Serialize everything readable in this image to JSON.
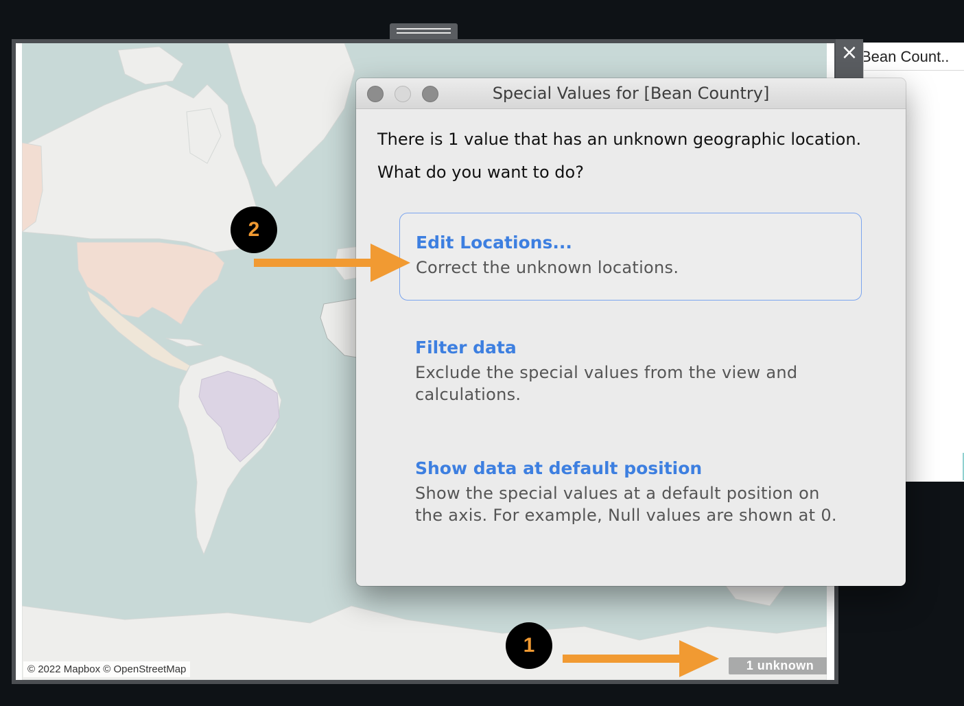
{
  "map": {
    "attribution": "© 2022 Mapbox © OpenStreetMap",
    "unknown_badge": "1 unknown"
  },
  "side_panel": {
    "title": "Bean Count..",
    "close_icon": "×"
  },
  "dialog": {
    "title": "Special Values for [Bean Country]",
    "message_line1": "There is 1 value that has an unknown geographic location.",
    "message_line2": "What do you want to do?",
    "options": [
      {
        "title": "Edit Locations...",
        "description": "Correct the unknown locations."
      },
      {
        "title": "Filter data",
        "description": "Exclude the special values from the view and calculations."
      },
      {
        "title": "Show data at default position",
        "description": "Show the special values at a default position on the axis. For example, Null values are shown at 0."
      }
    ]
  },
  "annotations": {
    "callout_1": "1",
    "callout_2": "2",
    "arrow_color": "#f19a32"
  },
  "colors": {
    "ocean": "#c8d9d7",
    "land": "#eeeeec",
    "usa": "#f2ddd2",
    "brazil": "#dcd4e4",
    "link_blue": "#3d7fe0"
  }
}
